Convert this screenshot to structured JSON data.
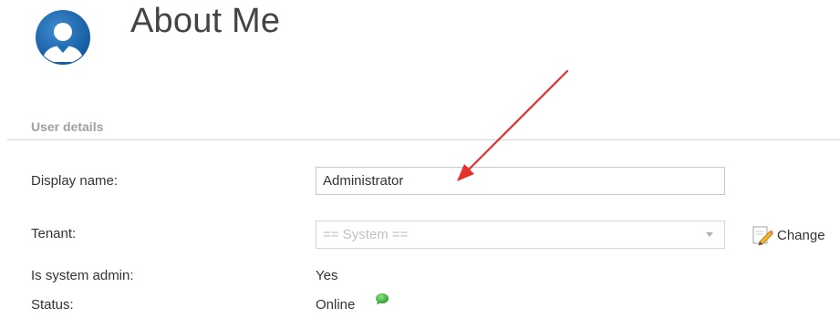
{
  "header": {
    "title": "About Me",
    "avatar_icon": "user-avatar-icon"
  },
  "section": {
    "title": "User details"
  },
  "form": {
    "display_name": {
      "label": "Display name:",
      "value": "Administrator"
    },
    "tenant": {
      "label": "Tenant:",
      "selected": "== System ==",
      "change_label": "Change",
      "change_icon": "pencil-icon"
    },
    "system_admin": {
      "label": "Is system admin:",
      "value": "Yes"
    },
    "status": {
      "label": "Status:",
      "value": "Online",
      "indicator_icon": "online-status-icon",
      "indicator_color": "#3cb83c"
    }
  },
  "annotation": {
    "arrow_color": "#e8302a"
  },
  "colors": {
    "avatar_primary": "#1e6fb5",
    "section_title": "#a0a0a0"
  }
}
